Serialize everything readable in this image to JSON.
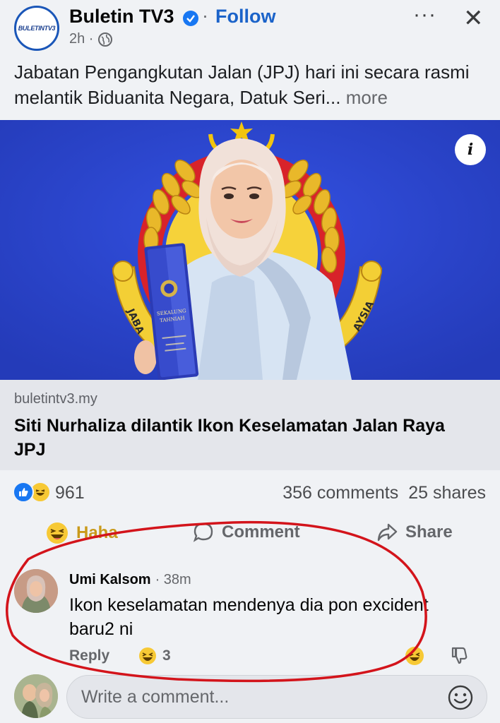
{
  "post": {
    "page_name": "Buletin TV3",
    "logo_text": "BULETINTV3",
    "dot": "·",
    "follow_label": "Follow",
    "time": "2h ·",
    "more_options": "···",
    "close": "✕",
    "text": "Jabatan Pengangkutan Jalan (JPJ) hari ini secara rasmi melantik Biduanita Negara, Datuk Seri...",
    "more_label": "more"
  },
  "photo": {
    "info_label": "i",
    "trophy_text_1": "SEKALUNG",
    "trophy_text_2": "TAHNIAH",
    "emblem_left": "JABA",
    "emblem_right": "AYSIA"
  },
  "link_card": {
    "domain": "buletintv3.my",
    "title": "Siti Nurhaliza dilantik Ikon Keselamatan Jalan Raya JPJ"
  },
  "stats": {
    "reaction_count": "961",
    "comments": "356 comments",
    "shares": "25 shares"
  },
  "actions": {
    "haha_label": "Haha",
    "comment_label": "Comment",
    "share_label": "Share"
  },
  "comment": {
    "author": "Umi Kalsom",
    "time": "· 38m",
    "text": "Ikon keselamatan mendenya dia pon excident baru2 ni",
    "reply_label": "Reply",
    "reaction_count": "3"
  },
  "composer": {
    "placeholder": "Write a comment..."
  },
  "colors": {
    "accent": "#1877f2",
    "follow": "#1b63c9",
    "photo_bg": "#2b47d6",
    "annotation": "#d3141b"
  }
}
